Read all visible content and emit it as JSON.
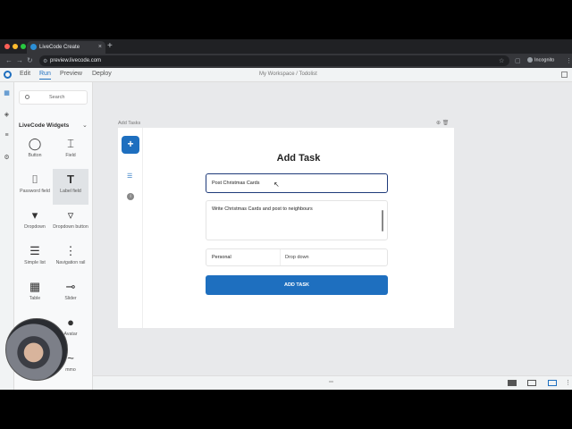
{
  "browser": {
    "tab_title": "LiveCode Create",
    "url": "preview.livecode.com",
    "profile": "Incognito",
    "icons": [
      "back-icon",
      "forward-icon",
      "reload-icon",
      "star-icon",
      "sidepanel-icon",
      "menu-icon"
    ]
  },
  "app": {
    "modes": [
      "Edit",
      "Run",
      "Preview",
      "Deploy"
    ],
    "active_mode": "Run",
    "workspace": "My Workspace / Todolist",
    "accent": "#1e6fbf"
  },
  "palette": {
    "search_placeholder": "Search",
    "section": "LiveCode Widgets",
    "widgets": [
      {
        "label": "Button",
        "icon": "button-icon"
      },
      {
        "label": "Field",
        "icon": "field-icon"
      },
      {
        "label": "Password field",
        "icon": "password-field-icon"
      },
      {
        "label": "Label field",
        "icon": "label-field-icon",
        "selected": true
      },
      {
        "label": "Dropdown",
        "icon": "dropdown-icon"
      },
      {
        "label": "Dropdown button",
        "icon": "dropdown-button-icon"
      },
      {
        "label": "Simple list",
        "icon": "list-icon"
      },
      {
        "label": "Navigation rail",
        "icon": "navigation-rail-icon"
      },
      {
        "label": "Table",
        "icon": "table-icon"
      },
      {
        "label": "Slider",
        "icon": "slider-icon"
      },
      {
        "label": "",
        "icon": "avatar-icon"
      },
      {
        "label": "Avatar",
        "icon": "avatar-icon"
      },
      {
        "label": "",
        "icon": "logo-icon"
      },
      {
        "label": "mmo",
        "icon": "logo-icon"
      }
    ]
  },
  "card": {
    "label": "Add Tasks",
    "form_title": "Add Task",
    "task_value": "Post Christmas Cards",
    "description_value": "Write Christmas Cards and post to neighbours",
    "category_label": "Personal",
    "category_value": "Drop down",
    "submit_label": "ADD TASK"
  }
}
